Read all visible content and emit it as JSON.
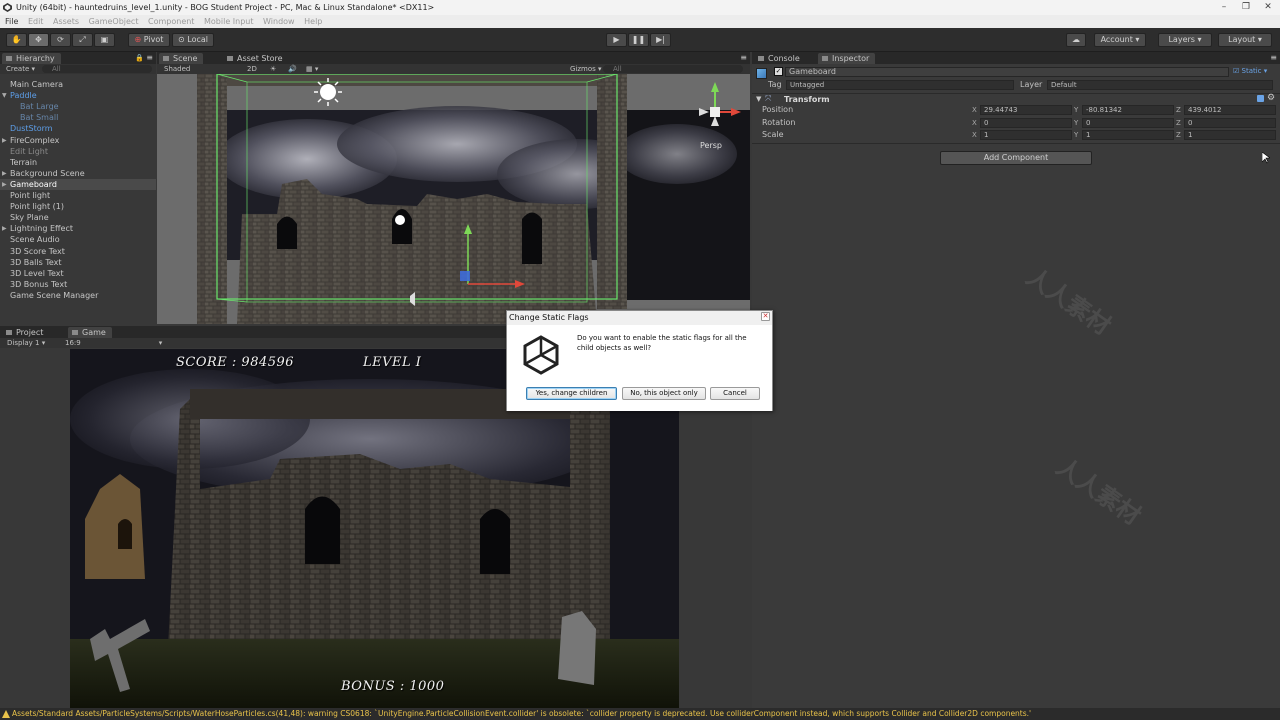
{
  "window": {
    "title": "Unity (64bit) - hauntedruins_level_1.unity - BOG Student Project - PC, Mac & Linux Standalone* <DX11>"
  },
  "menu": [
    "File",
    "Edit",
    "Assets",
    "GameObject",
    "Component",
    "Mobile Input",
    "Window",
    "Help"
  ],
  "toolbar": {
    "pivot": "Pivot",
    "local": "Local",
    "account": "Account",
    "layers": "Layers",
    "layout": "Layout"
  },
  "hierarchy": {
    "tab": "Hierarchy",
    "create": "Create",
    "search_placeholder": "All",
    "items": [
      {
        "label": "Main Camera"
      },
      {
        "label": "Paddle"
      },
      {
        "label": "Bat Large"
      },
      {
        "label": "Bat Small"
      },
      {
        "label": "DustStorm"
      },
      {
        "label": "FireComplex"
      },
      {
        "label": "Edit Light"
      },
      {
        "label": "Terrain"
      },
      {
        "label": "Background Scene"
      },
      {
        "label": "Gameboard"
      },
      {
        "label": "Point light"
      },
      {
        "label": "Point light (1)"
      },
      {
        "label": "Sky Plane"
      },
      {
        "label": "Lightning Effect"
      },
      {
        "label": "Scene Audio"
      },
      {
        "label": "3D Score Text"
      },
      {
        "label": "3D Balls Text"
      },
      {
        "label": "3D Level Text"
      },
      {
        "label": "3D Bonus Text"
      },
      {
        "label": "Game Scene Manager"
      }
    ]
  },
  "scene": {
    "tab": "Scene",
    "asset_store_tab": "Asset Store",
    "shading": "Shaded",
    "mode_2d": "2D",
    "gizmos": "Gizmos",
    "search_placeholder": "All",
    "persp": "Persp"
  },
  "game": {
    "project_tab": "Project",
    "tab": "Game",
    "display": "Display 1",
    "aspect": "16:9",
    "score": "SCORE : 984596",
    "level": "LEVEL I",
    "bonus": "BONUS : 1000"
  },
  "inspector": {
    "console_tab": "Console",
    "tab": "Inspector",
    "object_name": "Gameboard",
    "static_label": "Static",
    "tag_label": "Tag",
    "tag_value": "Untagged",
    "layer_label": "Layer",
    "layer_value": "Default",
    "component": "Transform",
    "rows": [
      {
        "label": "Position",
        "x": "29.44743",
        "y": "-80.81342",
        "z": "439.4012"
      },
      {
        "label": "Rotation",
        "x": "0",
        "y": "0",
        "z": "0"
      },
      {
        "label": "Scale",
        "x": "1",
        "y": "1",
        "z": "1"
      }
    ],
    "axis_x": "X",
    "axis_y": "Y",
    "axis_z": "Z",
    "add_component": "Add Component"
  },
  "dialog": {
    "title": "Change Static Flags",
    "message": "Do you want to enable the static flags for all the child objects as well?",
    "yes": "Yes, change children",
    "no": "No, this object only",
    "cancel": "Cancel"
  },
  "status": {
    "message": "Assets/Standard Assets/ParticleSystems/Scripts/WaterHoseParticles.cs(41,48): warning CS0618: `UnityEngine.ParticleCollisionEvent.collider' is obsolete: `collider property is deprecated. Use colliderComponent instead, which supports Collider and Collider2D components.'"
  },
  "colors": {
    "selection_blue": "#5d9ee8",
    "warning": "#e8c24a",
    "editor_bg": "#383838"
  }
}
